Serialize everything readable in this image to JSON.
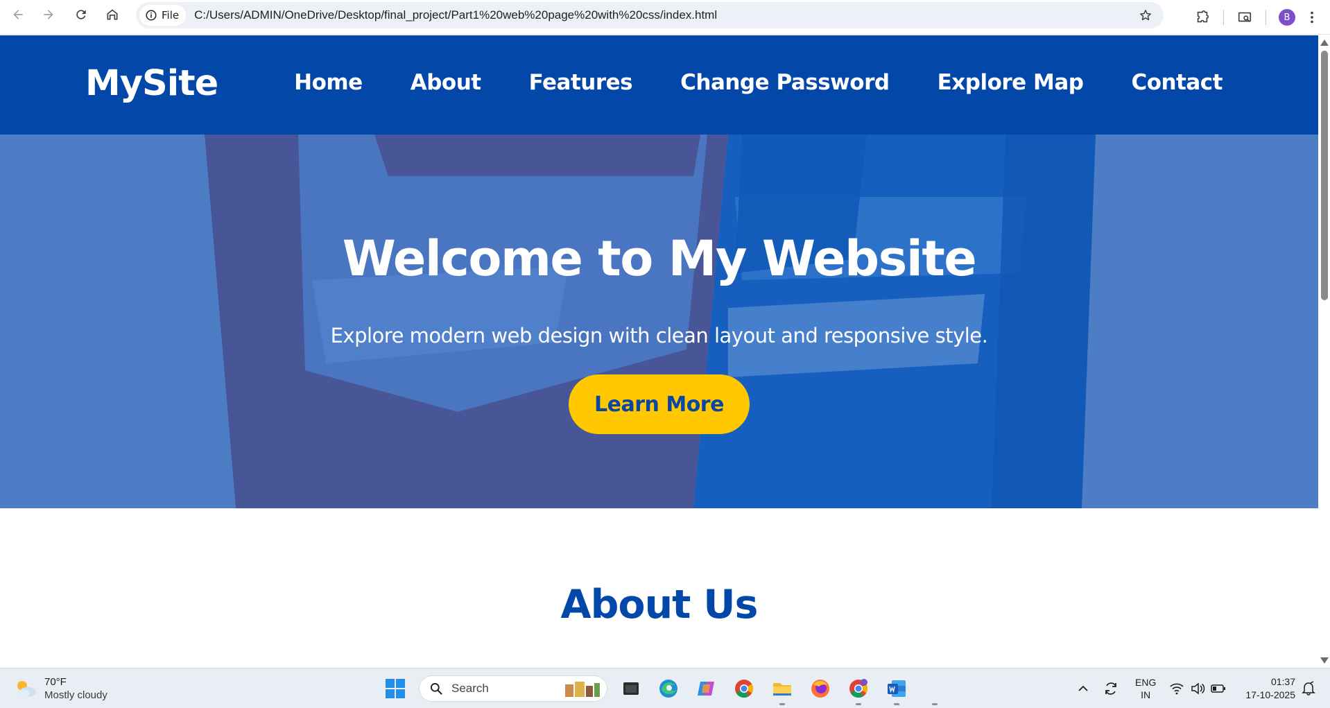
{
  "browser": {
    "site_chip_label": "File",
    "url": "C:/Users/ADMIN/OneDrive/Desktop/final_project/Part1%20web%20page%20with%20css/index.html",
    "profile_initial": "B"
  },
  "site": {
    "logo": "MySite",
    "nav": [
      "Home",
      "About",
      "Features",
      "Change Password",
      "Explore Map",
      "Contact"
    ],
    "hero": {
      "title": "Welcome to My Website",
      "subtitle": "Explore modern web design with clean layout and responsive style.",
      "cta": "Learn More"
    },
    "about_title": "About Us",
    "colors": {
      "header_bg": "#0347a8",
      "cta_bg": "#ffc800",
      "cta_text": "#0a46a3",
      "about_title": "#0347a8"
    }
  },
  "taskbar": {
    "weather": {
      "temp": "70°F",
      "condition": "Mostly cloudy"
    },
    "search_placeholder": "Search",
    "language": {
      "lang": "ENG",
      "region": "IN"
    },
    "time": "01:37",
    "date": "17-10-2025",
    "apps": [
      "file-explorer-icon",
      "edge-icon",
      "copilot-icon",
      "chrome-icon",
      "folder-icon",
      "firefox-icon",
      "chrome-profile-icon",
      "word-icon"
    ]
  }
}
